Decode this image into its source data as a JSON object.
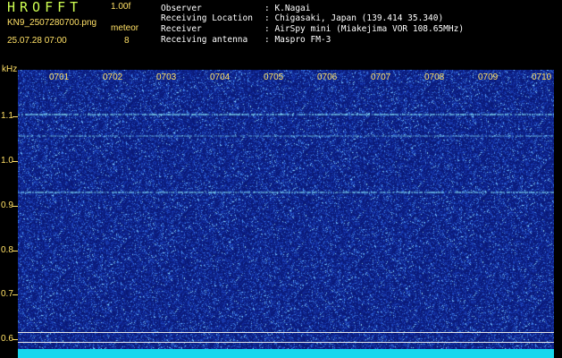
{
  "header": {
    "title": "HROFFT",
    "version": "1.00f",
    "filename": "KN9_2507280700.png",
    "meteor_label": "meteor",
    "datetime": "25.07.28 07:00",
    "meteor_count": "8"
  },
  "info": [
    {
      "key": "Observer",
      "value": ": K.Nagai"
    },
    {
      "key": "Receiving Location",
      "value": ": Chigasaki, Japan (139.414 35.340)"
    },
    {
      "key": "Receiver",
      "value": ": AirSpy mini (Miakejima VOR 108.65MHz)"
    },
    {
      "key": "Receiving antenna",
      "value": ": Maspro FM-3"
    }
  ],
  "spectrogram": {
    "y_unit": "kHz",
    "y_ticks": [
      "1.1",
      "1.0",
      "0.9",
      "0.8",
      "0.7",
      "0.6"
    ],
    "x_ticks": [
      "0701",
      "0702",
      "0703",
      "0704",
      "0705",
      "0706",
      "0707",
      "0708",
      "0709",
      "0710"
    ],
    "colors": {
      "background": "#0a1a78",
      "noise": "#5aa0ff",
      "signal": "#7ff0ff",
      "ref_line": "#e6e6e6",
      "label": "#ffe066",
      "title": "#cfff52",
      "strip": "#18d7ee"
    }
  }
}
